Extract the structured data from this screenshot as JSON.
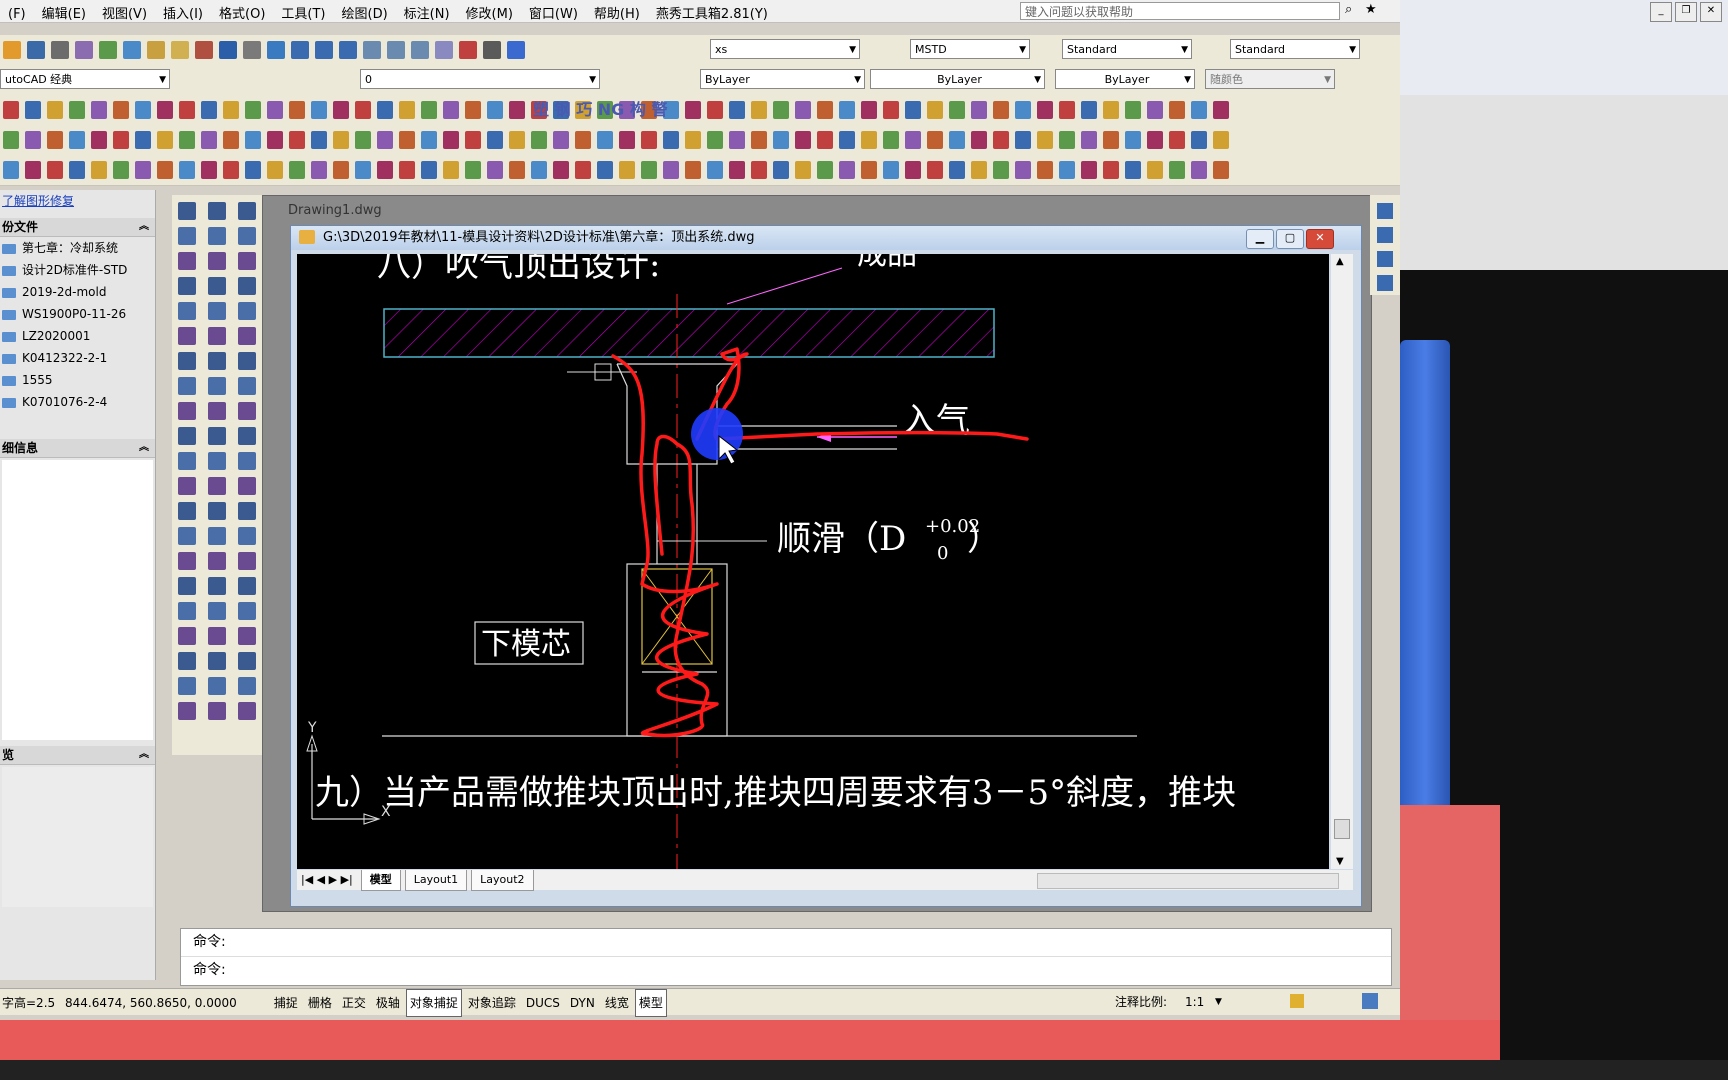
{
  "menu": [
    "(F)",
    "编辑(E)",
    "视图(V)",
    "插入(I)",
    "格式(O)",
    "工具(T)",
    "绘图(D)",
    "标注(N)",
    "修改(M)",
    "窗口(W)",
    "帮助(H)",
    "燕秀工具箱2.81(Y)"
  ],
  "help_search_placeholder": "键入问题以获取帮助",
  "toolbar1": {
    "text_style": "xs",
    "dim_style": "MSTD",
    "table_style": "Standard",
    "multileader_style": "Standard"
  },
  "toolbar2": {
    "workspace": "utoCAD 经典",
    "layer": "0",
    "color": "ByLayer",
    "linetype": "ByLayer",
    "lineweight": "ByLayer",
    "plotstyle": "随颜色"
  },
  "toolbar_labels": [
    "塑",
    "钢",
    "巧",
    "NG",
    "构",
    "警"
  ],
  "left_panel": {
    "top_link": "了解图形修复",
    "sections": {
      "files": "份文件",
      "details": "细信息",
      "preview": "览"
    },
    "files": [
      "第七章：冷却系统",
      "设计2D标准件-STD",
      "2019-2d-mold",
      "WS1900P0-11-26",
      "LZ2020001",
      "K0412322-2-1",
      "1555",
      "K0701076-2-4"
    ]
  },
  "mdi": {
    "drawing1_tab": "Drawing1.dwg",
    "window_title": "G:\\3D\\2019年教材\\11-模具设计资料\\2D设计标准\\第六章：顶出系统.dwg"
  },
  "drawing": {
    "heading_top": "八）吹气顶出设计:",
    "label_product": "成品",
    "label_air_in": "入气",
    "label_smooth": "顺滑（D",
    "label_tol_upper": "+0.02",
    "label_tol_lower": "0",
    "label_close_paren": "）",
    "label_core": "下模芯",
    "heading_bottom": "九）当产品需做推块顶出时,推块四周要求有3－5°斜度，推块",
    "axis_y": "Y",
    "axis_x": "X"
  },
  "layout_tabs": [
    "模型",
    "Layout1",
    "Layout2"
  ],
  "command_lines": [
    "命令:",
    "命令:"
  ],
  "status": {
    "text_height": "字高=2.5",
    "coords": "844.6474,  560.8650,  0.0000",
    "buttons": [
      "捕捉",
      "栅格",
      "正交",
      "极轴",
      "对象捕捉",
      "对象追踪",
      "DUCS",
      "DYN",
      "线宽",
      "模型"
    ],
    "anno_scale_label": "注释比例:",
    "anno_scale_value": "1:1"
  },
  "colors": {
    "canvas": "#000000",
    "red_markup": "#ff1a1a",
    "cyan_line": "#4fb3c8",
    "magenta": "#c800c8",
    "blue_cursor": "#1f3cff"
  }
}
